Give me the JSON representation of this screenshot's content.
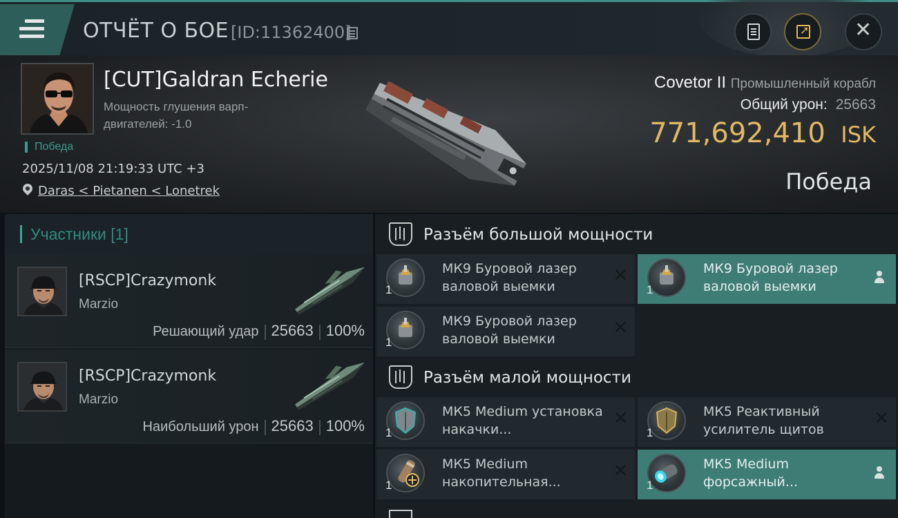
{
  "header": {
    "title": "ОТЧЁТ О БОЕ",
    "report_id": "[ID:11362400]",
    "icons": [
      "menu-icon",
      "copy-icon",
      "report-icon",
      "share-icon",
      "close-icon"
    ],
    "accent_color": "#3f8f86"
  },
  "victim": {
    "name": "[CUT]Galdran Echerie",
    "warp_scramble": "Мощность глушения варп-двигателей: -1.0",
    "result_tag": "Победа",
    "datetime": "2025/11/08 21:19:33 UTC +3",
    "location": "Daras < Pietanen < Lonetrek",
    "ship_name": "Covetor II",
    "ship_class": "Промышленный корабл",
    "total_damage_label": "Общий урон:",
    "total_damage": "25663",
    "isk_value": "771,692,410",
    "isk_unit": "ISK",
    "result": "Победа",
    "isk_color": "#e2b864"
  },
  "participants": {
    "title": "Участники [1]",
    "attackers": [
      {
        "name": "[RSCP]Crazymonk",
        "ship": "Marzio",
        "role": "Решающий удар",
        "damage": "25663",
        "percent": "100%"
      },
      {
        "name": "[RSCP]Crazymonk",
        "ship": "Marzio",
        "role": "Наибольший урон",
        "damage": "25663",
        "percent": "100%"
      }
    ]
  },
  "fitting": {
    "high_slots": {
      "title": "Разъём большой мощности",
      "modules": [
        {
          "name": "МК9 Буровой лазер валовой выемки",
          "qty": "1",
          "state": "destroyed"
        },
        {
          "name": "МК9 Буровой лазер валовой выемки",
          "qty": "1",
          "state": "dropped"
        },
        {
          "name": "МК9 Буровой лазер валовой выемки",
          "qty": "1",
          "state": "destroyed"
        }
      ]
    },
    "mid_slots": {
      "title": "Разъём малой мощности",
      "modules": [
        {
          "name": "МК5 Medium установка накачки...",
          "qty": "1",
          "state": "destroyed"
        },
        {
          "name": "МК5 Реактивный усилитель щитов",
          "qty": "1",
          "state": "destroyed"
        },
        {
          "name": "МК5 Medium накопительная...",
          "qty": "1",
          "state": "destroyed"
        },
        {
          "name": "МК5 Medium форсажный...",
          "qty": "1",
          "state": "dropped"
        }
      ]
    },
    "active_color": "#3e7d76"
  }
}
